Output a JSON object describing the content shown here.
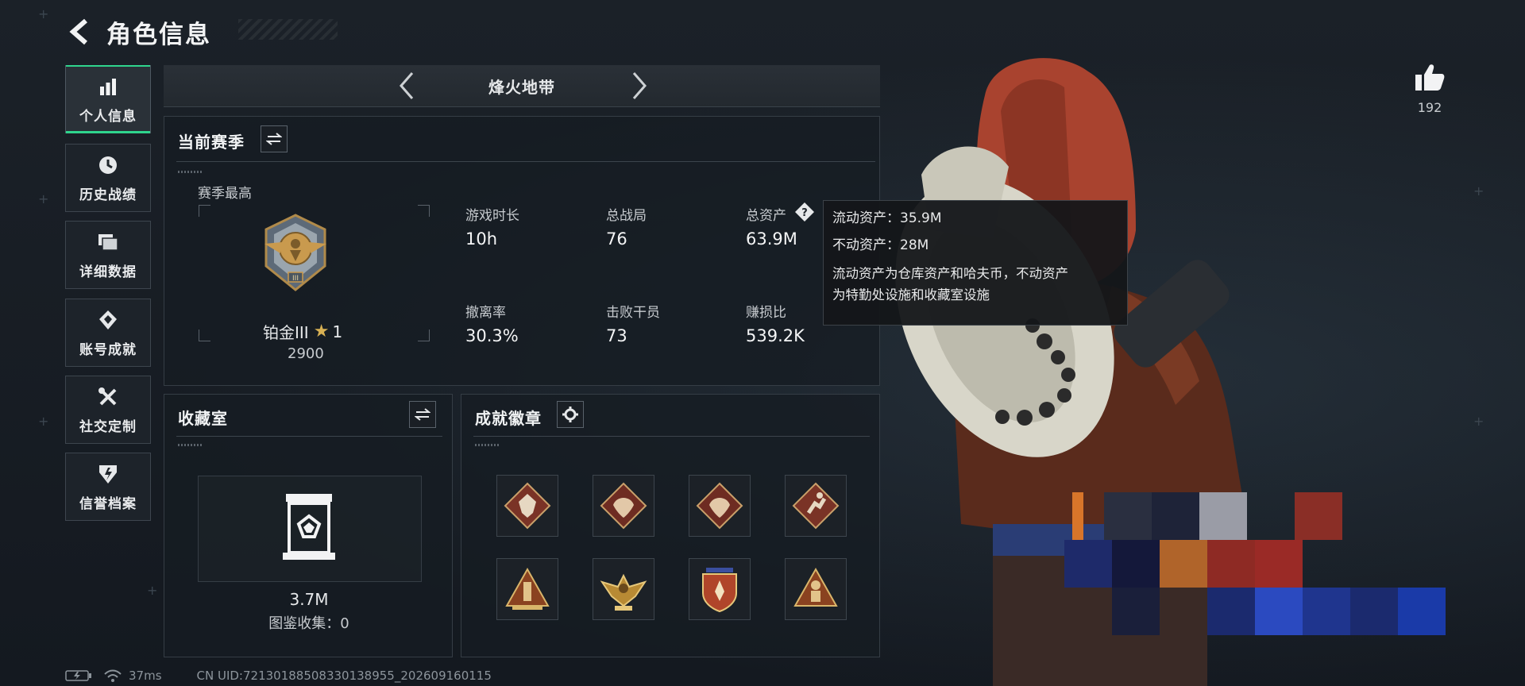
{
  "header": {
    "title": "角色信息"
  },
  "nav": [
    {
      "label": "个人信息",
      "icon": "bar-chart-icon",
      "active": true
    },
    {
      "label": "历史战绩",
      "icon": "history-clock-icon",
      "active": false
    },
    {
      "label": "详细数据",
      "icon": "folders-icon",
      "active": false
    },
    {
      "label": "账号成就",
      "icon": "achievement-diamond-icon",
      "active": false
    },
    {
      "label": "社交定制",
      "icon": "tools-icon",
      "active": false
    },
    {
      "label": "信誉档案",
      "icon": "reputation-shield-icon",
      "active": false
    }
  ],
  "mode": {
    "title": "烽火地带"
  },
  "season": {
    "title": "当前赛季",
    "best_label": "赛季最高",
    "rank_name": "铂金III",
    "rank_stars": "1",
    "rank_score": "2900",
    "stats": [
      {
        "label": "游戏时长",
        "value": "10h"
      },
      {
        "label": "总战局",
        "value": "76"
      },
      {
        "label": "总资产",
        "value": "63.9M"
      },
      {
        "label": "撤离率",
        "value": "30.3%"
      },
      {
        "label": "击败干员",
        "value": "73"
      },
      {
        "label": "赚损比",
        "value": "539.2K"
      }
    ]
  },
  "tooltip": {
    "liquid": "流动资产：35.9M",
    "fixed": "不动资产：28M",
    "desc_line1": "流动资产为仓库资产和哈夫币，不动资产",
    "desc_line2": "为特勤处设施和收藏室设施"
  },
  "collection": {
    "title": "收藏室",
    "value": "3.7M",
    "codex": "图鉴收集：0"
  },
  "badges": {
    "title": "成就徽章",
    "items": [
      {
        "icon": "wolf-badge-icon",
        "color": "#8a3a2a"
      },
      {
        "icon": "dragon-badge-icon",
        "color": "#7a3326"
      },
      {
        "icon": "dragon-badge-icon",
        "color": "#7a3326"
      },
      {
        "icon": "runner-badge-icon",
        "color": "#8a3a2a"
      },
      {
        "icon": "pyramid-badge-icon",
        "color": "#9a4a22"
      },
      {
        "icon": "eagle-badge-icon",
        "color": "#a67c2c"
      },
      {
        "icon": "shield-badge-icon",
        "color": "#b0452a"
      },
      {
        "icon": "soldier-badge-icon",
        "color": "#9a4a22"
      }
    ]
  },
  "like": {
    "count": "192"
  },
  "footer": {
    "ping": "37ms",
    "uid": "CN UID:72130188508330138955_202609160115"
  },
  "colors": {
    "accent": "#2fd58d",
    "background": "#161b21",
    "hair": "#a9432f",
    "hat": "#d8d6c9"
  }
}
